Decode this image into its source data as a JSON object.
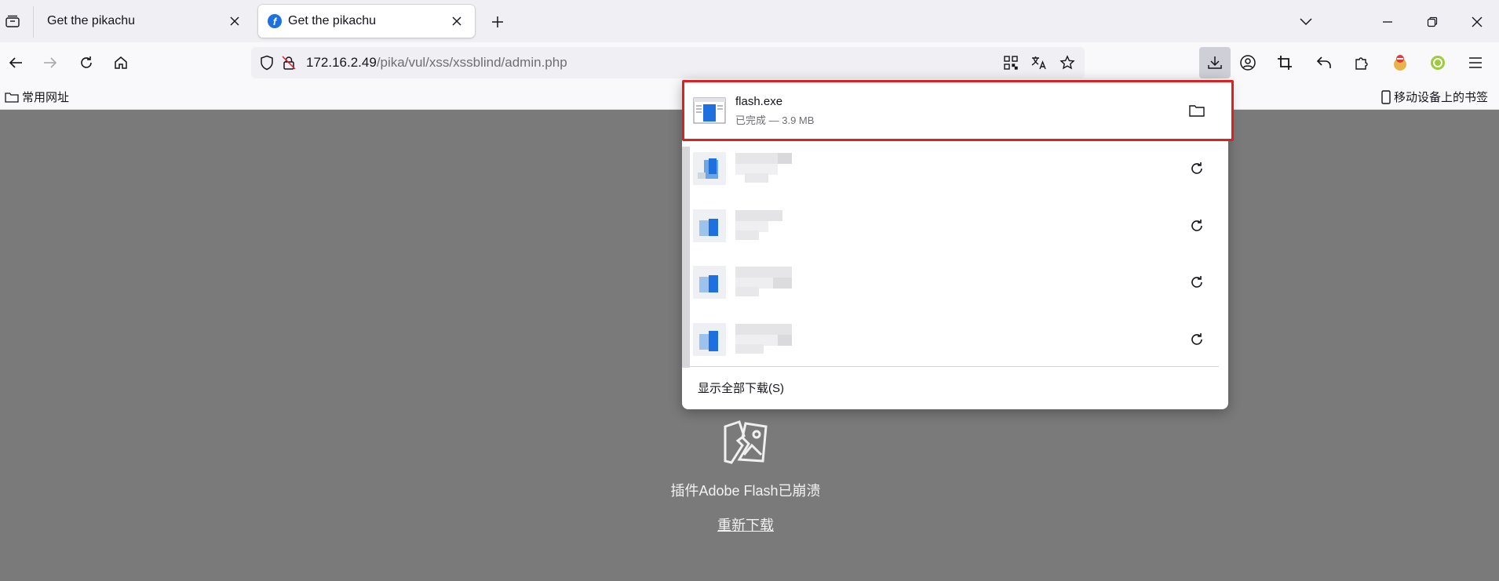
{
  "tabs": [
    {
      "title": "Get the pikachu"
    },
    {
      "title": "Get the pikachu",
      "favicon": "flash-icon"
    }
  ],
  "navbar": {
    "url_host": "172.16.2.49",
    "url_path": "/pika/vul/xss/xssblind/admin.php"
  },
  "bookmarks": {
    "left_label": "常用网址",
    "right_label": "移动设备上的书签"
  },
  "page": {
    "crash_message": "插件Adobe Flash已崩溃",
    "reload_link": "重新下载"
  },
  "downloads": {
    "items": [
      {
        "name": "flash.exe",
        "status": "已完成 — 3.9 MB",
        "action_icon": "folder-icon"
      },
      {
        "name": "",
        "status": "",
        "action_icon": "retry-icon"
      },
      {
        "name": "",
        "status": "",
        "action_icon": "retry-icon"
      },
      {
        "name": "",
        "status": "",
        "action_icon": "retry-icon"
      },
      {
        "name": "",
        "status": "",
        "action_icon": "retry-icon"
      }
    ],
    "show_all_label": "显示全部下载(S)"
  },
  "colors": {
    "highlight": "#e02020",
    "accent": "#1e6fe0",
    "page_bg": "#7a7a7a"
  }
}
